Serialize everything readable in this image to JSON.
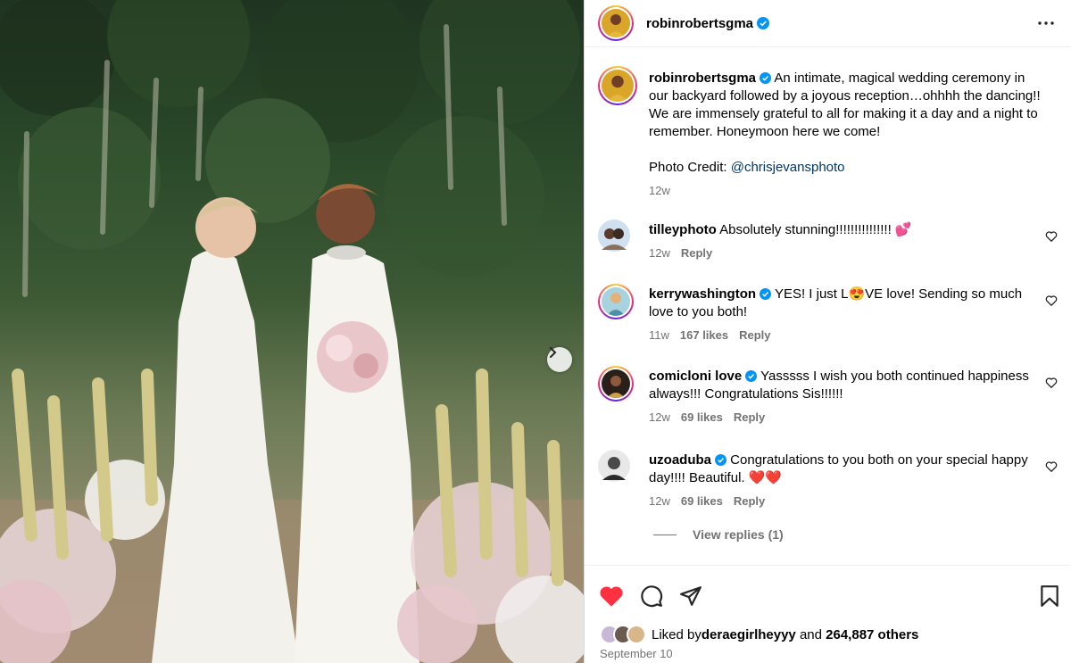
{
  "post": {
    "author": "robinrobertsgma",
    "caption": "An intimate, magical wedding ceremony in our backyard followed by a joyous reception…ohhhh the dancing!! We are immensely grateful to all for making it a day and a night to remember. Honeymoon here we come!",
    "credit_prefix": "Photo Credit: ",
    "credit_handle": "@chrisjevansphoto",
    "age": "12w"
  },
  "comments": [
    {
      "user": "tilleyphoto",
      "verified": false,
      "text": "Absolutely stunning!!!!!!!!!!!!!!! 💕",
      "age": "12w",
      "likes": "",
      "reply": "Reply"
    },
    {
      "user": "kerrywashington",
      "verified": true,
      "text": "YES! I just L😍VE love! Sending so much love to you both!",
      "age": "11w",
      "likes": "167 likes",
      "reply": "Reply"
    },
    {
      "user": "comicloni love",
      "verified": true,
      "text": "Yasssss I wish you both continued happiness always!!! Congratulations Sis!!!!!!",
      "age": "12w",
      "likes": "69 likes",
      "reply": "Reply"
    },
    {
      "user": "uzoaduba",
      "verified": true,
      "text": "Congratulations to you both on your special happy day!!!! Beautiful. ❤️❤️",
      "age": "12w",
      "likes": "69 likes",
      "reply": "Reply",
      "view_replies": "View replies (1)"
    }
  ],
  "footer": {
    "liked_by_prefix": "Liked by ",
    "liked_by_user": "deraegirlheyyy",
    "and_text": " and ",
    "others": "264,887 others",
    "date": "September 10"
  },
  "icons": {
    "like": "heart-filled-icon",
    "comment": "comment-bubble-icon",
    "share": "paper-plane-icon",
    "save": "bookmark-icon",
    "more": "ellipsis-icon",
    "next": "chevron-right-icon"
  },
  "colors": {
    "like_red": "#ff3040",
    "verified_blue": "#0095f6",
    "link_blue": "#00376b",
    "muted": "#737373"
  }
}
